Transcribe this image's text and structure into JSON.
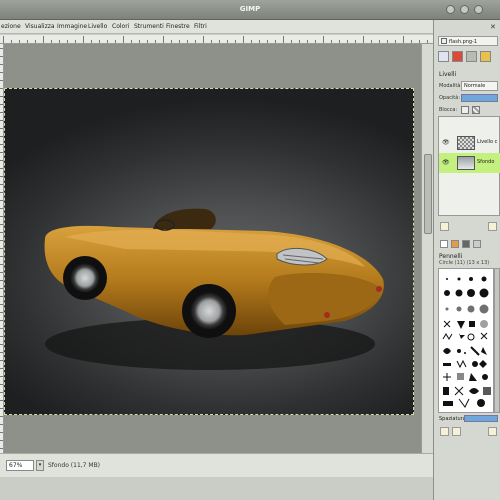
{
  "window": {
    "title": "GIMP"
  },
  "menubar": {
    "items": [
      "ezione",
      "Visualizza",
      "Immagine",
      "Livello",
      "Colori",
      "Strumenti",
      "Finestre",
      "Filtri"
    ]
  },
  "statusbar": {
    "zoom": "67%",
    "unit_arrow": "▾",
    "status": "Sfondo (11,7 MB)"
  },
  "dock": {
    "image_name": "flash.png-1",
    "layers_title": "Livelli",
    "mode_label": "Modalità:",
    "mode_value": "Normale",
    "opacity_label": "Opacità:",
    "lock_label": "Blocca:",
    "layers": [
      {
        "name": "Livello c",
        "visible": true,
        "active": false
      },
      {
        "name": "Sfondo",
        "visible": true,
        "active": true
      }
    ],
    "brushes_title": "Pennelli",
    "brush_name": "Circle (11) (13 x 13)",
    "spacing_label": "Spaziatura"
  },
  "colors": {
    "accent_active_layer": "#c3f07e",
    "slider_blue": "#6fa7dd",
    "car_body": "#b8801e"
  },
  "icons": [
    "close-icon",
    "eye-icon",
    "lock-pixels-icon",
    "lock-alpha-icon",
    "new-layer-icon",
    "brush-thumbnail-icon"
  ]
}
